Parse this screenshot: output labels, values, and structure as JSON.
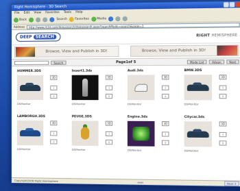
{
  "window": {
    "title": "Right Hemisphere - 3D Search",
    "menu": [
      "File",
      "Edit",
      "View",
      "Favorites",
      "Tools",
      "Help"
    ],
    "toolbar": {
      "back": "Back",
      "search": "Search",
      "favorites": "Favorites",
      "media": "Media"
    },
    "address_label": "Address",
    "address": "http://www.rh3d.com/deepsearch/deepsearch.aspx?searchMode=search&page=1"
  },
  "header": {
    "logo_deep": "DEEP",
    "logo_search": "SEARCH",
    "brand_bold": "RIGHT",
    "brand_light": "HEMISPHERE"
  },
  "banners": [
    {
      "text": "Browse, View and Publish in 3D!"
    },
    {
      "text": "Browse, View and Publish in 3D!"
    }
  ],
  "filter": {
    "input_value": "",
    "search_button": "Search",
    "page_label": "Page1of 5",
    "mode_button": "Mode List",
    "prev_button": "Advan",
    "next_button": "Next"
  },
  "items": [
    {
      "title": "HUMMER.3DS",
      "tag": "DSMonitor",
      "thumb": "car-dark",
      "btn1": "3D",
      "btn2": "i",
      "btn3": "⇩"
    },
    {
      "title": "Insert1.3ds",
      "tag": "DSMonitor",
      "thumb": "figure",
      "btn1": "3D",
      "btn2": "i",
      "btn3": "⇩"
    },
    {
      "title": "Audi.3ds",
      "tag": "DSMonitor",
      "thumb": "shoe",
      "btn1": "3D",
      "btn2": "i",
      "btn3": "⇩"
    },
    {
      "title": "BMW.3DS",
      "tag": "DSMonitor",
      "thumb": "car-dark",
      "btn1": "3D",
      "btn2": "i",
      "btn3": "⇩"
    },
    {
      "title": "LAMBORGH.3DS",
      "tag": "DSMonitor",
      "thumb": "car-blue",
      "btn1": "3D",
      "btn2": "i",
      "btn3": "⇩"
    },
    {
      "title": "PEUGE.3DS",
      "tag": "DSMonitor",
      "thumb": "pineapple",
      "btn1": "3D",
      "btn2": "i",
      "btn3": "⇩"
    },
    {
      "title": "Engine.3ds",
      "tag": "DSMonitor",
      "thumb": "engine",
      "btn1": "3D",
      "btn2": "i",
      "btn3": "⇩"
    },
    {
      "title": "Citycar.3ds",
      "tag": "DSMonitor",
      "thumb": "car-dark",
      "btn1": "3D",
      "btn2": "i",
      "btn3": "⇩"
    }
  ],
  "status": {
    "left": "Copyright2006 Right Hemisphere",
    "center": "",
    "right": "Next 3"
  },
  "colors": {
    "brand_blue": "#1e3c8c",
    "titlebar": "#1e4fbf",
    "desktop": "#1c4aa6"
  }
}
